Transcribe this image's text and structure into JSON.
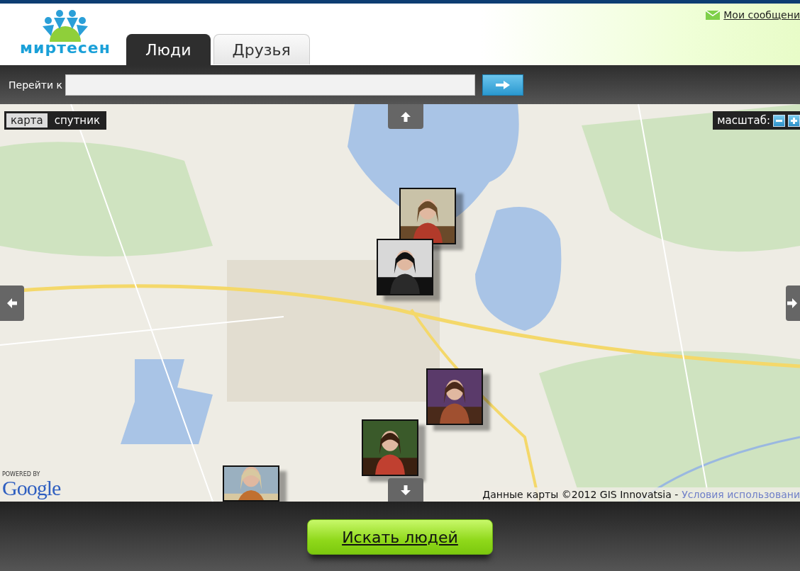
{
  "header": {
    "logo_text": "миртесен",
    "messages_link": "Мои сообщени"
  },
  "tabs": [
    {
      "label": "Люди",
      "selected": true
    },
    {
      "label": "Друзья",
      "selected": false
    }
  ],
  "goto": {
    "label": "Перейти к"
  },
  "map": {
    "map_types": [
      {
        "label": "карта",
        "selected": true
      },
      {
        "label": "спутник",
        "selected": false
      }
    ],
    "zoom_label": "масштаб:",
    "powered_by": "POWERED BY",
    "google": "Google",
    "attribution": "Данные карты ©2012 GIS Innovatsia - ",
    "terms_link": "Условия использовани"
  },
  "search_button": "Искать людей"
}
